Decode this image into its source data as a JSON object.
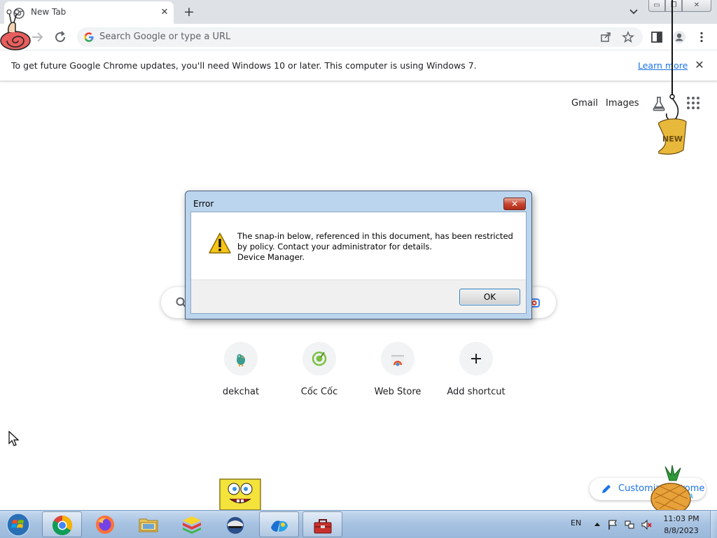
{
  "browser": {
    "tab": {
      "title": "New Tab",
      "close_glyph": "✕"
    },
    "new_tab_glyph": "+",
    "window_buttons": {
      "minimize": "▭",
      "maximize": "❐",
      "close": "✕"
    },
    "omnibox": {
      "placeholder": "Search Google or type a URL"
    },
    "icons": {
      "back": "back-arrow-icon",
      "forward": "forward-arrow-icon",
      "reload": "reload-icon",
      "share": "share-icon",
      "bookmark": "star-icon",
      "side_panel": "side-panel-icon",
      "profile": "profile-icon",
      "menu": "kebab-menu-icon"
    }
  },
  "infobar": {
    "message": "To get future Google Chrome updates, you'll need Windows 10 or later. This computer is using Windows 7.",
    "link": "Learn more",
    "close_glyph": "✕"
  },
  "ntp": {
    "header_links": {
      "gmail": "Gmail",
      "images": "Images"
    },
    "shortcuts": [
      {
        "label": "dekchat",
        "icon": "dekchat-bird-icon"
      },
      {
        "label": "Cốc Cốc",
        "icon": "coccoc-icon"
      },
      {
        "label": "Web Store",
        "icon": "web-store-icon"
      },
      {
        "label": "Add shortcut",
        "icon": "plus-icon",
        "glyph": "+"
      }
    ],
    "customize_label": "Customize Chrome"
  },
  "dialog": {
    "title": "Error",
    "close_glyph": "✕",
    "message_line1": "The snap-in below, referenced in this document, has been restricted by policy. Contact your administrator for details.",
    "message_line2": "Device Manager.",
    "ok_label": "OK"
  },
  "taskbar": {
    "apps": [
      {
        "name": "chrome",
        "icon": "chrome-icon",
        "active": true
      },
      {
        "name": "firefox",
        "icon": "firefox-icon",
        "active": false
      },
      {
        "name": "file-explorer",
        "icon": "folder-icon",
        "active": false
      },
      {
        "name": "bluestacks",
        "icon": "bluestacks-icon",
        "active": false
      },
      {
        "name": "app-globe-helmet",
        "icon": "globe-helmet-icon",
        "active": false
      },
      {
        "name": "app-blue-logo",
        "icon": "blue-logo-icon",
        "active": true
      },
      {
        "name": "toolbox",
        "icon": "toolbox-icon",
        "active": true
      }
    ],
    "tray": {
      "language": "EN",
      "time": "11:03 PM",
      "date": "8/8/2023"
    }
  },
  "desktop_decorations": {
    "new_badge_text": "NEW"
  },
  "colors": {
    "accent": "#1a73e8",
    "tabstrip": "#dee1e6",
    "dialog_frame": "#bcd5ee",
    "taskbar": "#a8c3e2"
  }
}
